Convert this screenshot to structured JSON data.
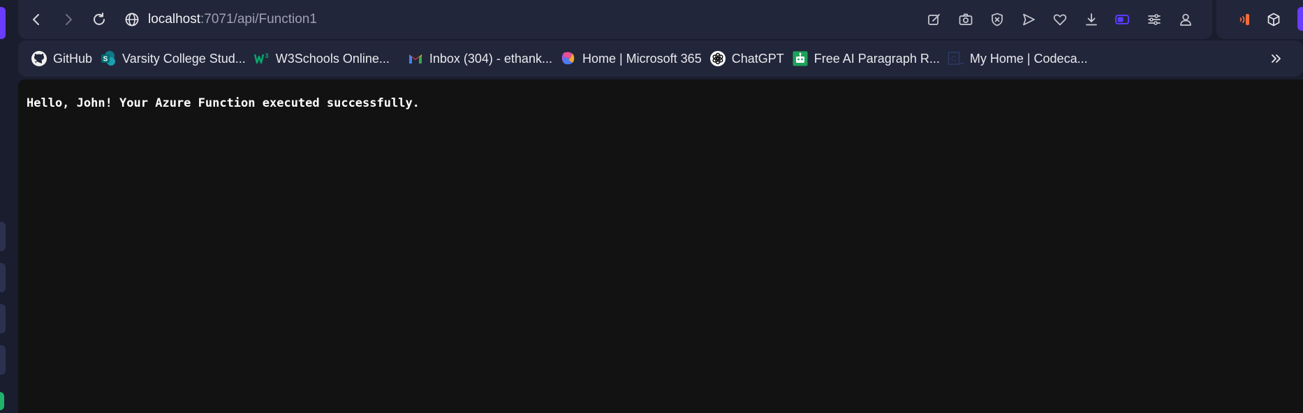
{
  "browser": {
    "url_host": "localhost",
    "url_path": ":7071/api/Function1",
    "nav_icons": [
      "back-icon",
      "forward-icon",
      "reload-icon",
      "site-info-icon"
    ],
    "toolbar_icons": [
      "edit-icon",
      "camera-icon",
      "shield-icon",
      "send-icon",
      "heart-icon",
      "download-icon",
      "battery-icon",
      "settings-sliders-icon",
      "profile-icon"
    ],
    "extension_icons": [
      "audio-extension-icon",
      "cube-icon"
    ],
    "accent_color": "#6a3cff"
  },
  "bookmarks": [
    {
      "label": "GitHub",
      "icon": "github-icon"
    },
    {
      "label": "Varsity College Stud...",
      "icon": "sharepoint-icon"
    },
    {
      "label": "W3Schools Online...",
      "icon": "w3schools-icon"
    },
    {
      "label": "Inbox (304) - ethank...",
      "icon": "gmail-icon"
    },
    {
      "label": "Home | Microsoft 365",
      "icon": "microsoft365-icon"
    },
    {
      "label": "ChatGPT",
      "icon": "chatgpt-icon"
    },
    {
      "label": "Free AI Paragraph R...",
      "icon": "robot-icon"
    },
    {
      "label": "My Home | Codeca...",
      "icon": "codecademy-icon"
    }
  ],
  "page": {
    "response_text": "Hello, John! Your Azure Function executed successfully."
  }
}
